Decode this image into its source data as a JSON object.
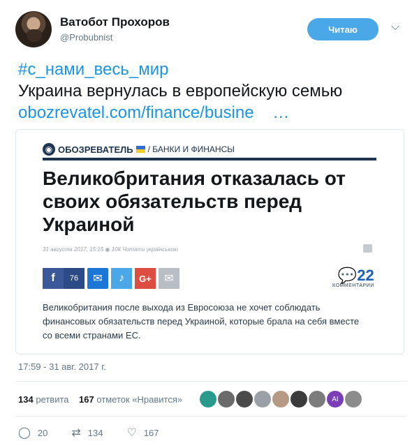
{
  "header": {
    "name": "Ватобот Прохоров",
    "handle": "@Probubnist",
    "follow_label": "Читаю",
    "menu_icon": "chevron-down"
  },
  "tweet": {
    "hashtag": "#с_нами_весь_мир",
    "text": "Украина вернулась в европейскую семью",
    "link": "obozrevatel.com/finance/busine",
    "link_ellipsis": "…"
  },
  "card": {
    "brand_name": "ОБОЗРЕВАТЕЛЬ",
    "section": "/ БАНКИ И ФИНАНСЫ",
    "headline": "Великобритания отказалась от своих обязательств перед Украиной",
    "meta": "31 августа 2017, 15:15   ◉ 10К   Читати українською",
    "share": {
      "facebook_count": "76"
    },
    "comments": {
      "count": "22",
      "label": "КОММЕНТАРИИ"
    },
    "summary": "Великобритания после выхода из Евросоюза не хочет соблюдать финансовых обязательств перед Украиной, которые брала на себя вместе со всеми странами ЕС."
  },
  "timestamp": "17:59 - 31 авг. 2017 г.",
  "stats": {
    "retweets_count": "134",
    "retweets_label": "ретвита",
    "likes_count": "167",
    "likes_label": "отметок «Нравится»"
  },
  "likers": [
    {
      "name": "liker-1",
      "color": "#2a9a8f"
    },
    {
      "name": "liker-2",
      "color": "#6b6b6b"
    },
    {
      "name": "liker-3",
      "color": "#4a4a4a"
    },
    {
      "name": "liker-4",
      "color": "#9aa0a6"
    },
    {
      "name": "liker-5",
      "color": "#b59a86"
    },
    {
      "name": "liker-6",
      "color": "#3b3b3b"
    },
    {
      "name": "liker-7",
      "color": "#7c7c7c"
    },
    {
      "name": "liker-8",
      "color": "#7a3fb5",
      "initials": "AI"
    },
    {
      "name": "liker-9",
      "color": "#8c8c8c"
    }
  ],
  "actions": {
    "replies": "20",
    "retweets": "134",
    "likes": "167"
  },
  "colors": {
    "accent": "#1b95e0",
    "follow_button": "#4aa8e8",
    "brand_navy": "#20344e"
  }
}
